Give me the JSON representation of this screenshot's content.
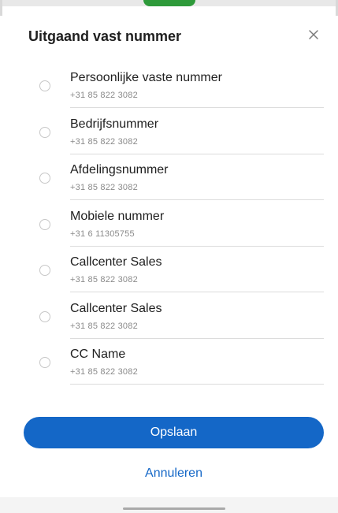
{
  "dialog": {
    "title": "Uitgaand vast nummer",
    "close_icon": "close-icon"
  },
  "options": [
    {
      "label": "Persoonlijke vaste nummer",
      "number": "+31 85 822 3082",
      "selected": false
    },
    {
      "label": "Bedrijfsnummer",
      "number": "+31 85 822 3082",
      "selected": false
    },
    {
      "label": "Afdelingsnummer",
      "number": "+31 85 822 3082",
      "selected": false
    },
    {
      "label": "Mobiele nummer",
      "number": "+31 6 11305755",
      "selected": false
    },
    {
      "label": "Callcenter Sales",
      "number": "+31 85 822 3082",
      "selected": false
    },
    {
      "label": "Callcenter Sales",
      "number": "+31 85 822 3082",
      "selected": false
    },
    {
      "label": "CC Name",
      "number": "+31 85 822 3082",
      "selected": false
    }
  ],
  "actions": {
    "save_label": "Opslaan",
    "cancel_label": "Annuleren"
  },
  "colors": {
    "accent": "#1467c7",
    "status_green": "#2e9a3a"
  }
}
